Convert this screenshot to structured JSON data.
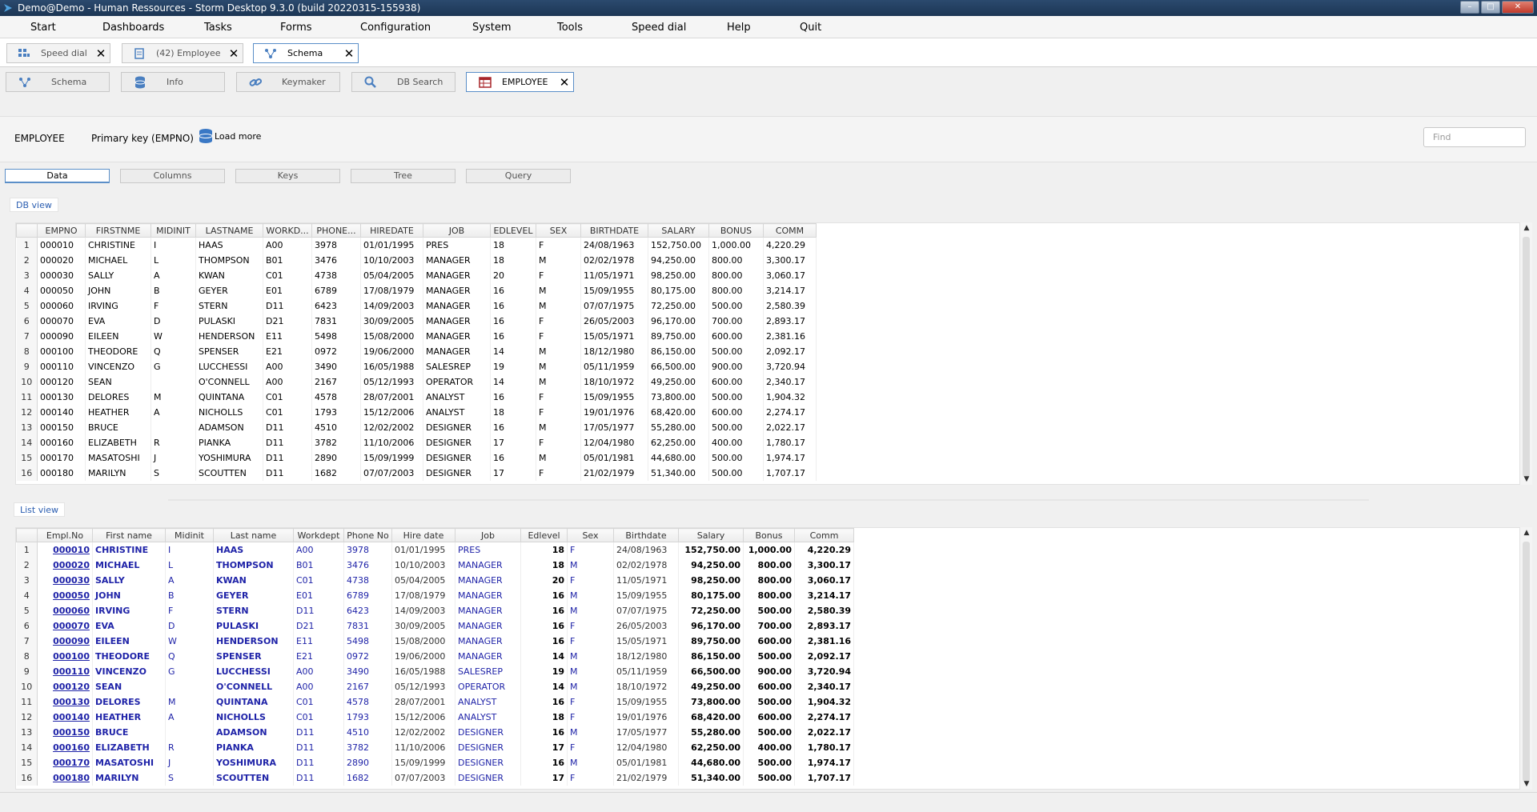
{
  "window": {
    "title": "Demo@Demo - Human Ressources - Storm Desktop 9.3.0 (build 20220315-155938)"
  },
  "menu": [
    "Start",
    "Dashboards",
    "Tasks",
    "Forms",
    "Configuration",
    "System",
    "Tools",
    "Speed dial",
    "Help",
    "Quit"
  ],
  "main_tabs": [
    {
      "label": "Speed dial",
      "icon": "speed-dial-icon"
    },
    {
      "label": "(42) Employee",
      "icon": "form-icon"
    },
    {
      "label": "Schema",
      "icon": "schema-icon"
    }
  ],
  "schema_tabs": [
    {
      "label": "Schema",
      "icon": "schema-icon"
    },
    {
      "label": "Info",
      "icon": "database-icon"
    },
    {
      "label": "Keymaker",
      "icon": "link-icon"
    },
    {
      "label": "DB Search",
      "icon": "search-icon"
    },
    {
      "label": "EMPLOYEE",
      "icon": "table-icon"
    }
  ],
  "toolbar": {
    "table_name": "EMPLOYEE",
    "primary_key": "Primary key (EMPNO)",
    "load_more": "Load more",
    "find_placeholder": "Find"
  },
  "sub_tabs": [
    "Data",
    "Columns",
    "Keys",
    "Tree",
    "Query"
  ],
  "db_view": {
    "label": "DB view",
    "columns": [
      "EMPNO",
      "FIRSTNME",
      "MIDINIT",
      "LASTNAME",
      "WORKD...",
      "PHONE...",
      "HIREDATE",
      "JOB",
      "EDLEVEL",
      "SEX",
      "BIRTHDATE",
      "SALARY",
      "BONUS",
      "COMM"
    ],
    "rows": [
      [
        "000010",
        "CHRISTINE",
        "I",
        "HAAS",
        "A00",
        "3978",
        "01/01/1995",
        "PRES",
        "18",
        "F",
        "24/08/1963",
        "152,750.00",
        "1,000.00",
        "4,220.29"
      ],
      [
        "000020",
        "MICHAEL",
        "L",
        "THOMPSON",
        "B01",
        "3476",
        "10/10/2003",
        "MANAGER",
        "18",
        "M",
        "02/02/1978",
        "94,250.00",
        "800.00",
        "3,300.17"
      ],
      [
        "000030",
        "SALLY",
        "A",
        "KWAN",
        "C01",
        "4738",
        "05/04/2005",
        "MANAGER",
        "20",
        "F",
        "11/05/1971",
        "98,250.00",
        "800.00",
        "3,060.17"
      ],
      [
        "000050",
        "JOHN",
        "B",
        "GEYER",
        "E01",
        "6789",
        "17/08/1979",
        "MANAGER",
        "16",
        "M",
        "15/09/1955",
        "80,175.00",
        "800.00",
        "3,214.17"
      ],
      [
        "000060",
        "IRVING",
        "F",
        "STERN",
        "D11",
        "6423",
        "14/09/2003",
        "MANAGER",
        "16",
        "M",
        "07/07/1975",
        "72,250.00",
        "500.00",
        "2,580.39"
      ],
      [
        "000070",
        "EVA",
        "D",
        "PULASKI",
        "D21",
        "7831",
        "30/09/2005",
        "MANAGER",
        "16",
        "F",
        "26/05/2003",
        "96,170.00",
        "700.00",
        "2,893.17"
      ],
      [
        "000090",
        "EILEEN",
        "W",
        "HENDERSON",
        "E11",
        "5498",
        "15/08/2000",
        "MANAGER",
        "16",
        "F",
        "15/05/1971",
        "89,750.00",
        "600.00",
        "2,381.16"
      ],
      [
        "000100",
        "THEODORE",
        "Q",
        "SPENSER",
        "E21",
        "0972",
        "19/06/2000",
        "MANAGER",
        "14",
        "M",
        "18/12/1980",
        "86,150.00",
        "500.00",
        "2,092.17"
      ],
      [
        "000110",
        "VINCENZO",
        "G",
        "LUCCHESSI",
        "A00",
        "3490",
        "16/05/1988",
        "SALESREP",
        "19",
        "M",
        "05/11/1959",
        "66,500.00",
        "900.00",
        "3,720.94"
      ],
      [
        "000120",
        "SEAN",
        "",
        "O'CONNELL",
        "A00",
        "2167",
        "05/12/1993",
        "OPERATOR",
        "14",
        "M",
        "18/10/1972",
        "49,250.00",
        "600.00",
        "2,340.17"
      ],
      [
        "000130",
        "DELORES",
        "M",
        "QUINTANA",
        "C01",
        "4578",
        "28/07/2001",
        "ANALYST",
        "16",
        "F",
        "15/09/1955",
        "73,800.00",
        "500.00",
        "1,904.32"
      ],
      [
        "000140",
        "HEATHER",
        "A",
        "NICHOLLS",
        "C01",
        "1793",
        "15/12/2006",
        "ANALYST",
        "18",
        "F",
        "19/01/1976",
        "68,420.00",
        "600.00",
        "2,274.17"
      ],
      [
        "000150",
        "BRUCE",
        "",
        "ADAMSON",
        "D11",
        "4510",
        "12/02/2002",
        "DESIGNER",
        "16",
        "M",
        "17/05/1977",
        "55,280.00",
        "500.00",
        "2,022.17"
      ],
      [
        "000160",
        "ELIZABETH",
        "R",
        "PIANKA",
        "D11",
        "3782",
        "11/10/2006",
        "DESIGNER",
        "17",
        "F",
        "12/04/1980",
        "62,250.00",
        "400.00",
        "1,780.17"
      ],
      [
        "000170",
        "MASATOSHI",
        "J",
        "YOSHIMURA",
        "D11",
        "2890",
        "15/09/1999",
        "DESIGNER",
        "16",
        "M",
        "05/01/1981",
        "44,680.00",
        "500.00",
        "1,974.17"
      ],
      [
        "000180",
        "MARILYN",
        "S",
        "SCOUTTEN",
        "D11",
        "1682",
        "07/07/2003",
        "DESIGNER",
        "17",
        "F",
        "21/02/1979",
        "51,340.00",
        "500.00",
        "1,707.17"
      ]
    ]
  },
  "list_view": {
    "label": "List view",
    "columns": [
      "Empl.No",
      "First name",
      "Midinit",
      "Last name",
      "Workdept",
      "Phone No",
      "Hire date",
      "Job",
      "Edlevel",
      "Sex",
      "Birthdate",
      "Salary",
      "Bonus",
      "Comm"
    ]
  },
  "colors": {
    "accent": "#5b8fc8",
    "list_text": "#1f23a8",
    "section_label": "#2a5db0"
  }
}
